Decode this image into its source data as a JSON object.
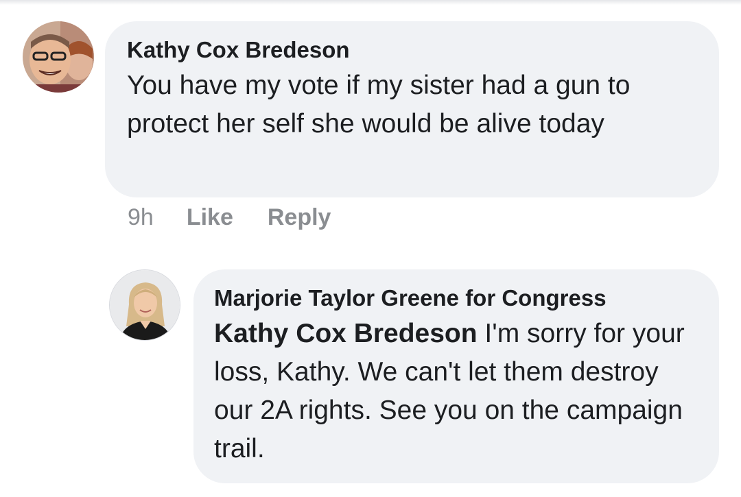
{
  "comments": [
    {
      "author": "Kathy Cox Bredeson",
      "text": "You have my vote if my sister had a gun to protect her self she would be alive today",
      "time": "9h",
      "like_label": "Like",
      "reply_label": "Reply"
    }
  ],
  "replies": [
    {
      "author": "Marjorie Taylor Greene for Congress",
      "mention": "Kathy Cox Bredeson",
      "text": " I'm sorry for your loss, Kathy. We can't let them destroy our 2A rights. See you on the campaign trail."
    }
  ],
  "colors": {
    "bubble_bg": "#f0f2f5",
    "text": "#1c1e21",
    "meta": "#8a8d91"
  }
}
